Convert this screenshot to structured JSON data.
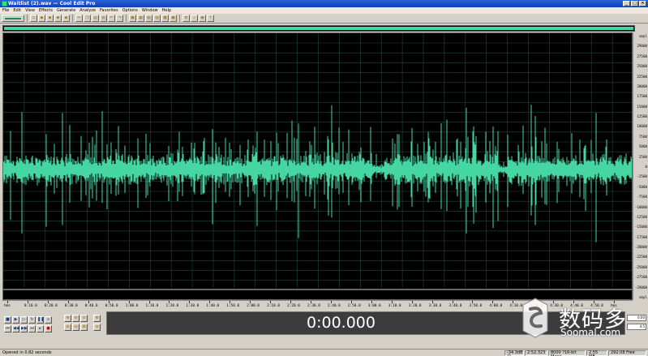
{
  "window": {
    "title": "Waitlist (2).wav — Cool Edit Pro"
  },
  "menu": [
    "File",
    "Edit",
    "View",
    "Effects",
    "Generate",
    "Analyze",
    "Favorites",
    "Options",
    "Window",
    "Help"
  ],
  "ruler": {
    "right_labels": [
      "smpl",
      "29000",
      "27500",
      "25000",
      "22500",
      "20000",
      "17500",
      "15000",
      "12500",
      "10000",
      "7500",
      "5000",
      "2500",
      "0",
      "-2500",
      "-5000",
      "-7500",
      "-10000",
      "-12500",
      "-15000",
      "-17500",
      "-20000",
      "-22500",
      "-25000",
      "-27500",
      "-29000",
      "smpl"
    ],
    "time_labels": [
      "hms",
      "0:10.0",
      "0:20.0",
      "0:30.0",
      "0:40.0",
      "0:50.0",
      "1:00.0",
      "1:10.0",
      "1:20.0",
      "1:30.0",
      "1:40.0",
      "1:50.0",
      "2:00.0",
      "2:10.0",
      "2:20.0",
      "2:30.0",
      "2:40.0",
      "2:50.0",
      "3:00.0",
      "3:10.0",
      "3:20.0",
      "3:30.0",
      "3:40.0",
      "3:50.0",
      "4:00.0",
      "4:10.0",
      "4:20.0",
      "4:30.0",
      "4:40.0",
      "4:50.0",
      "hms"
    ]
  },
  "time_display": {
    "value": "0:00.000"
  },
  "right_panel": {
    "begin": "0:00",
    "end": "4:5"
  },
  "status": {
    "left": "Opened in 0.82 seconds",
    "level": "-34.3dB @",
    "position": "2:52.323",
    "format": "8000 ?16-bit Mono",
    "size": "2.55 MB",
    "free": "292.08 Free"
  },
  "watermark": {
    "cn": "数码多",
    "en": "Soomal.com"
  },
  "colors": {
    "wave": "#46d6a4",
    "background": "#000000",
    "grid": "#1f4a3a"
  }
}
